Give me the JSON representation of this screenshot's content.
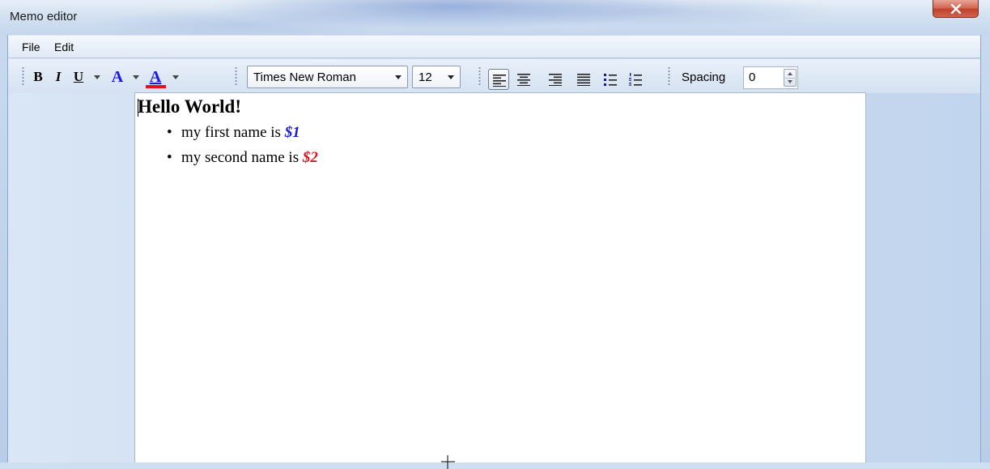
{
  "window": {
    "title": "Memo editor",
    "close_label": "X"
  },
  "menu": {
    "items": [
      "File",
      "Edit"
    ]
  },
  "toolbar": {
    "bold": "B",
    "italic": "I",
    "underline": "U",
    "font_color": "A",
    "highlight_color": "A",
    "font_name": "Times New Roman",
    "font_size": "12",
    "spacing_label": "Spacing",
    "spacing_value": "0",
    "alignment_selected": "left"
  },
  "document": {
    "heading": "Hello World!",
    "bullets": [
      {
        "text": "my first name is ",
        "variable": "$1",
        "variable_color": "#1a1adb"
      },
      {
        "text": "my second name is ",
        "variable": "$2",
        "variable_color": "#e0141e"
      }
    ]
  },
  "colors": {
    "font_color_bar": "#1a1adb",
    "highlight_bar": "#e0141e",
    "close_button": "#c84a33"
  }
}
